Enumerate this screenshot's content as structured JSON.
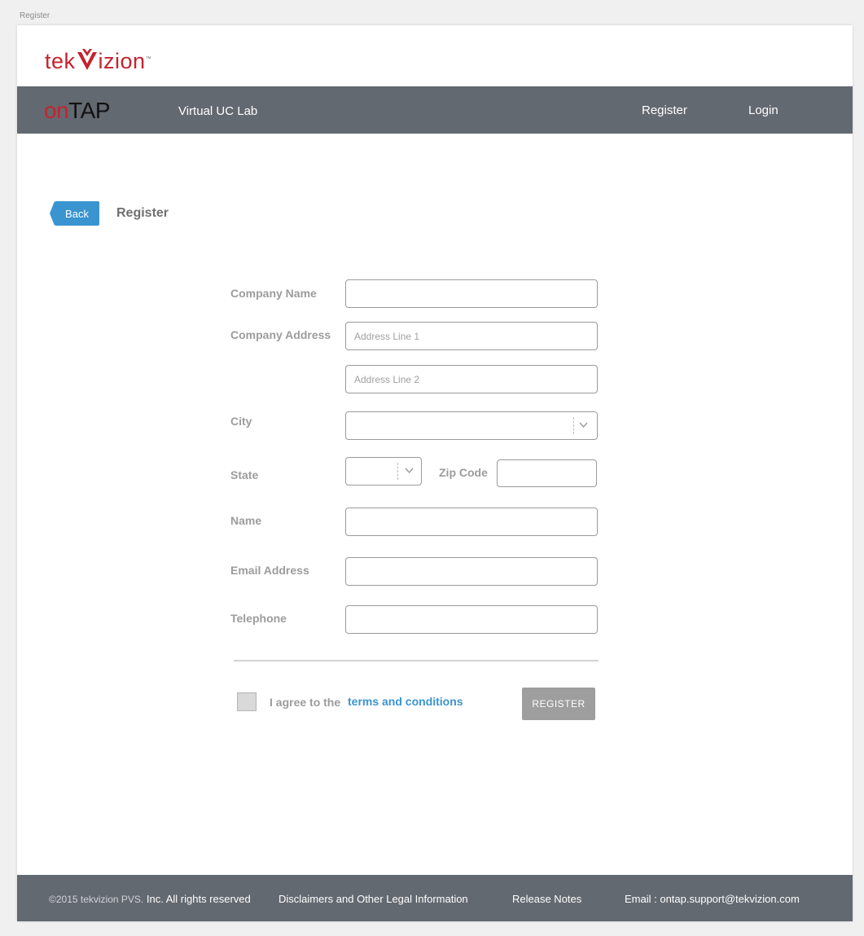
{
  "page_label": "Register",
  "brand": {
    "logo_left": "tek",
    "logo_right": "izion",
    "logo_tm": "™",
    "product_on": "on",
    "product_tap": "TAP",
    "subtitle": "Virtual UC Lab"
  },
  "nav": {
    "register": "Register",
    "login": "Login"
  },
  "header": {
    "back_label": "Back",
    "title": "Register"
  },
  "form": {
    "company_name": {
      "label": "Company Name",
      "value": ""
    },
    "company_address": {
      "label": "Company Address",
      "line1_placeholder": "Address Line 1",
      "line2_placeholder": "Address Line 2"
    },
    "city": {
      "label": "City",
      "value": "",
      "icon": "chevron-down-icon"
    },
    "state": {
      "label": "State",
      "value": "",
      "icon": "chevron-down-icon"
    },
    "zip": {
      "label": "Zip Code",
      "value": ""
    },
    "name": {
      "label": "Name",
      "value": ""
    },
    "email": {
      "label": "Email Address",
      "value": ""
    },
    "telephone": {
      "label": "Telephone",
      "value": ""
    },
    "agree_text": "I agree to the",
    "terms_link": "terms and conditions",
    "agree_checked": false,
    "submit_label": "REGISTER"
  },
  "footer": {
    "copyright_light": "©2015 tekvizion PVS.",
    "copyright_rest": "Inc. All rights reserved",
    "disclaimers": "Disclaimers and Other Legal Information",
    "release_notes": "Release Notes",
    "email": "Email : ontap.support@tekvizion.com"
  },
  "colors": {
    "brand_red": "#c4232e",
    "nav_gray": "#636971",
    "link_blue": "#3a94d0",
    "button_gray": "#9e9e9e"
  }
}
